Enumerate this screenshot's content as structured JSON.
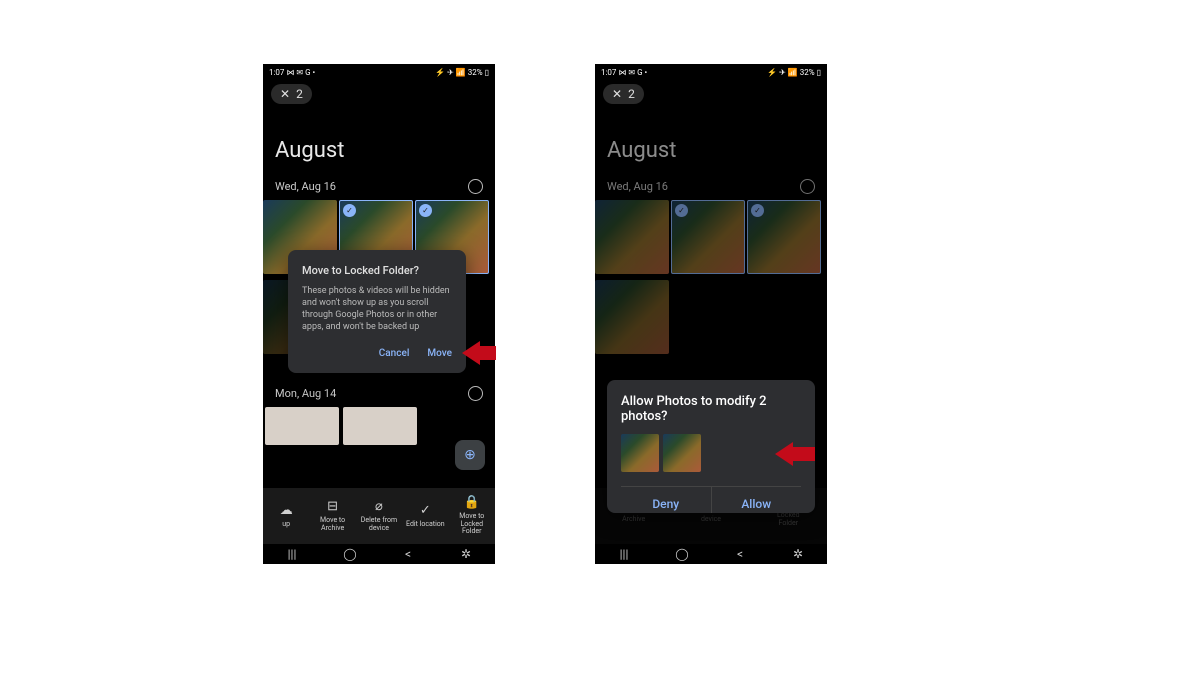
{
  "status": {
    "time": "1:07",
    "icons_left": "⋈ ✉ G •",
    "icons_right": "⚡ ✈ 📶",
    "battery": "32%"
  },
  "top": {
    "count": "2"
  },
  "month": "August",
  "dates": {
    "d1": "Wed, Aug 16",
    "d2": "Mon, Aug 14"
  },
  "actions": {
    "backup": "up",
    "archive": "Move to Archive",
    "delete": "Delete from device",
    "edit": "Edit location",
    "locked": "Move to Locked Folder"
  },
  "dialog1": {
    "title": "Move to Locked Folder?",
    "body": "These photos & videos will be hidden and won't show up as you scroll through Google Photos or in other apps, and won't be backed up",
    "cancel": "Cancel",
    "move": "Move"
  },
  "dialog2": {
    "title": "Allow Photos to modify 2 photos?",
    "deny": "Deny",
    "allow": "Allow"
  },
  "nav": {
    "recents": "|||",
    "home": "◯",
    "back": "<",
    "a11y": "✲"
  }
}
